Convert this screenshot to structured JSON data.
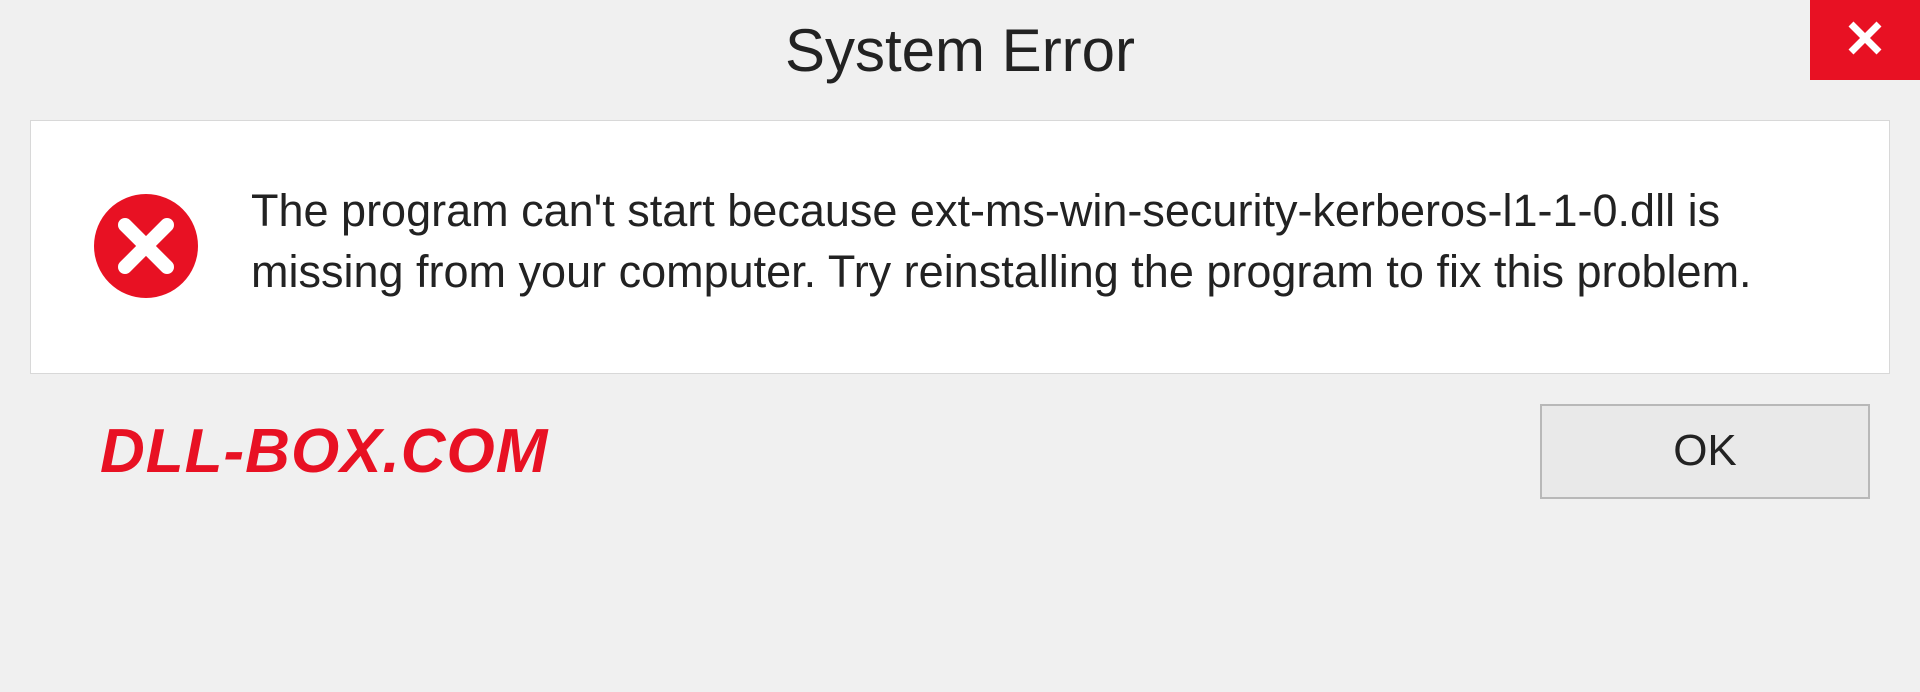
{
  "dialog": {
    "title": "System Error",
    "message": "The program can't start because ext-ms-win-security-kerberos-l1-1-0.dll is missing from your computer. Try reinstalling the program to fix this problem.",
    "ok_label": "OK"
  },
  "watermark": "DLL-BOX.COM",
  "colors": {
    "error_red": "#e81123",
    "background": "#f0f0f0",
    "content_bg": "#ffffff"
  }
}
